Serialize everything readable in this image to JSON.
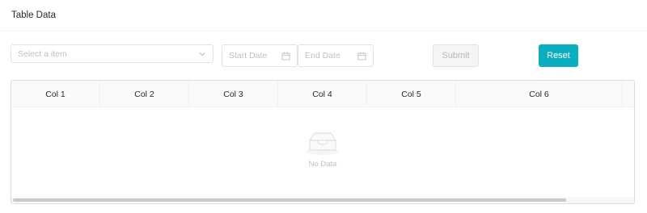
{
  "page": {
    "title": "Table Data"
  },
  "filters": {
    "select": {
      "placeholder": "Select a item",
      "icon": "chevron-down-icon"
    },
    "start_date": {
      "placeholder": "Start Date",
      "icon": "calendar-icon"
    },
    "end_date": {
      "placeholder": "End Date",
      "icon": "calendar-icon"
    },
    "submit_label": "Submit",
    "reset_label": "Reset"
  },
  "table": {
    "columns": [
      "Col 1",
      "Col 2",
      "Col 3",
      "Col 4",
      "Col 5",
      "Col 6"
    ],
    "empty_text": "No Data"
  },
  "colors": {
    "accent": "#0aaebf",
    "disabled_bg": "#f5f5f5",
    "border": "#e2e2e2"
  }
}
